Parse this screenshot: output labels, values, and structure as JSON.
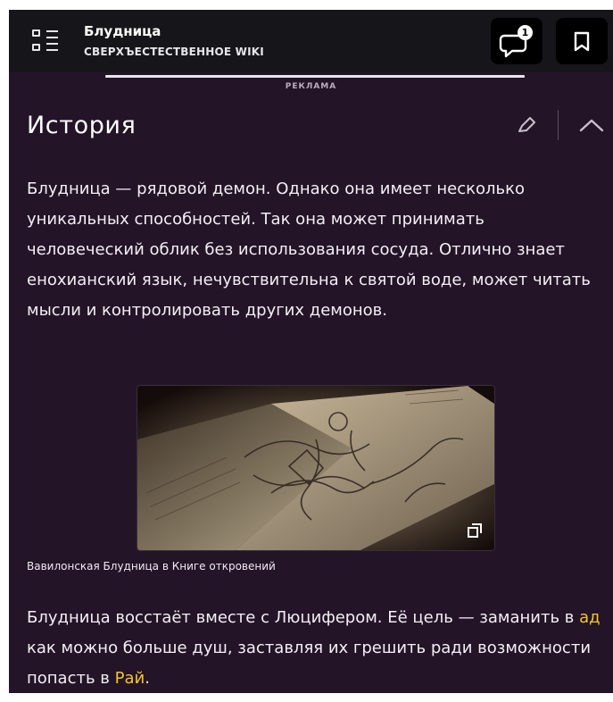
{
  "header": {
    "page_title": "Блудница",
    "wiki_name": "СВЕРХЪЕСТЕСТВЕННОЕ WIKI",
    "comments_count": "1",
    "menu_icon": "menu-grid-icon",
    "comments_icon": "comment-bubble-icon",
    "bookmark_icon": "bookmark-icon"
  },
  "ad": {
    "label": "РЕКЛАМА"
  },
  "section": {
    "heading": "История",
    "edit_icon": "pencil-icon",
    "collapse_icon": "chevron-up-icon",
    "paragraph1": "Блудница — рядовой демон. Однако она имеет несколько уникальных способностей. Так она может принимать человеческий облик без использования сосуда. Отлично знает енохианский язык, нечувствительна к святой воде, может читать мысли и контролировать других демонов.",
    "figure": {
      "caption": "Вавилонская Блудница в Книге откровений",
      "expand_icon": "expand-image-icon"
    },
    "paragraph2": {
      "part1": "Блудница восстаёт вместе с Люцифером. Её цель — заманить в ",
      "link1": "ад",
      "part2": " как можно больше душ, заставляя их грешить ради возможности попасть в ",
      "link2": "Рай",
      "part3": "."
    }
  },
  "colors": {
    "background": "#231427",
    "header": "#16161a",
    "link": "#f6c52a",
    "text": "#f4eef6"
  }
}
